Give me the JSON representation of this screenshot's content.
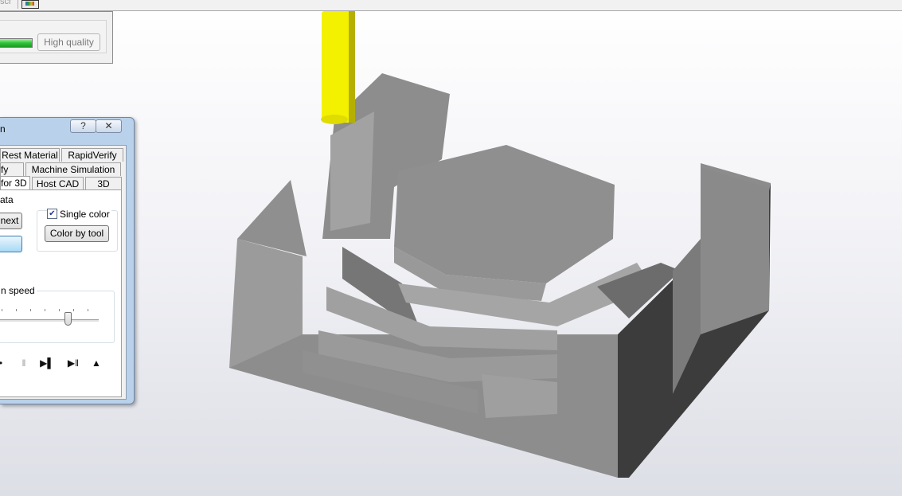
{
  "toolbar": {
    "cut_label": "scr",
    "icon": "color-palette-icon"
  },
  "quality_panel": {
    "progress": 1.0,
    "high_quality_label": "High quality"
  },
  "dialog": {
    "title": "n",
    "help_glyph": "?",
    "close_glyph": "✕",
    "tabs_row1": [
      "Rest Material",
      "RapidVerify"
    ],
    "tabs_row2": [
      "fy",
      "Machine Simulation"
    ],
    "tabs_row3": [
      "for 3D",
      "Host CAD",
      "3D"
    ],
    "active_tab": "for 3D",
    "data_label": "ata",
    "next_button": "next",
    "single_color_label": "Single color",
    "single_color_checked": true,
    "color_by_tool_button": "Color by tool",
    "speed_label": "n speed",
    "speed_value": 0.68,
    "controls": [
      "•",
      "‖",
      "▶▌",
      "▶‖",
      "▲"
    ]
  },
  "colors": {
    "tool": "#f3f000",
    "part_top": "#8a8a8a",
    "part_shadow": "#3a3a3a",
    "window_frame": "#b9d1ea"
  }
}
